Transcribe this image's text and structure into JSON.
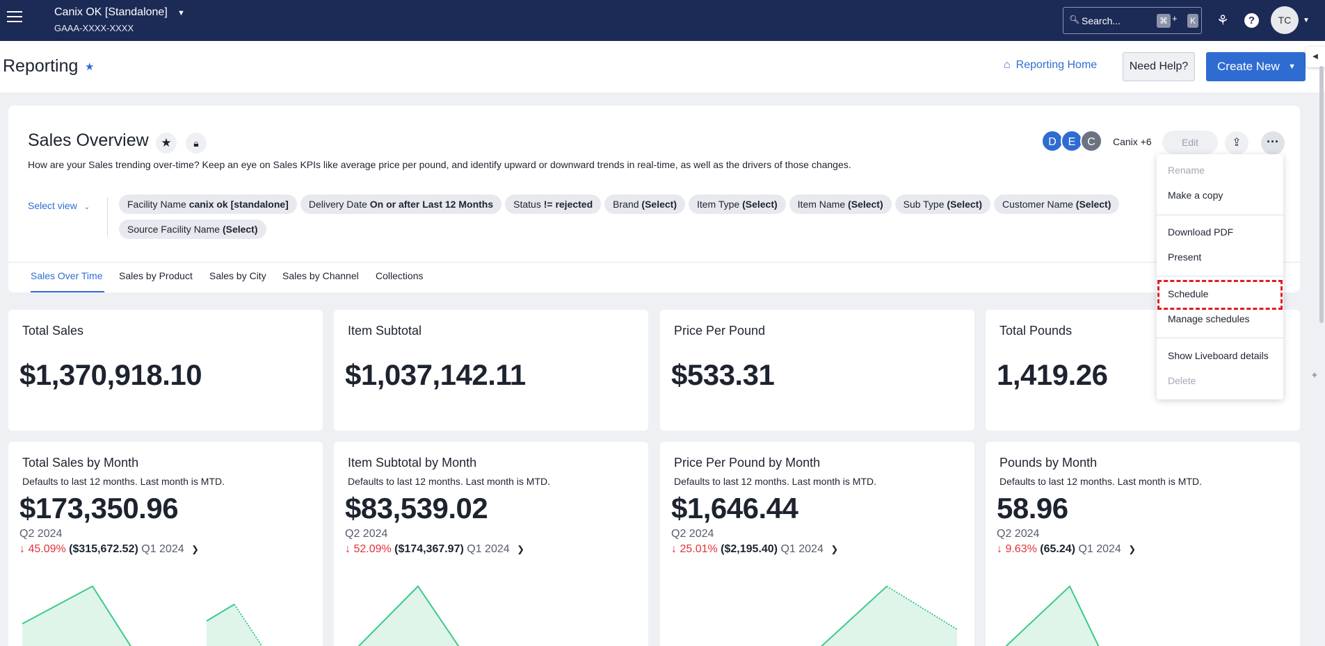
{
  "topbar": {
    "org_name": "Canix OK [Standalone]",
    "org_id": "GAAA-XXXX-XXXX",
    "search_placeholder": "Search...",
    "search_shortcut_key1": "⌘",
    "search_shortcut_plus": "+",
    "search_shortcut_key2": "K",
    "user_initials": "TC"
  },
  "header": {
    "title": "Reporting",
    "home_link": "Reporting Home",
    "help_button": "Need Help?",
    "create_button": "Create New"
  },
  "liveboard": {
    "title": "Sales Overview",
    "description": "How are your Sales trending over-time? Keep an eye on Sales KPIs like average price per pound, and identify upward or downward trends in real-time, as well as the drivers of those changes.",
    "select_view": "Select view",
    "collaborators": [
      "D",
      "E",
      "C"
    ],
    "collaborator_colors": [
      "#2f6cd2",
      "#2f6cd2",
      "#6b7280"
    ],
    "collaborators_text": "Canix +6",
    "edit_button": "Edit",
    "filters": [
      {
        "label": "Facility Name",
        "value": "canix ok [standalone]"
      },
      {
        "label": "Delivery Date",
        "value": "On or after Last 12 Months"
      },
      {
        "label": "Status",
        "value": "!= rejected"
      },
      {
        "label": "Brand",
        "value": "(Select)"
      },
      {
        "label": "Item Type",
        "value": "(Select)"
      },
      {
        "label": "Item Name",
        "value": "(Select)"
      },
      {
        "label": "Sub Type",
        "value": "(Select)"
      },
      {
        "label": "Customer Name",
        "value": "(Select)"
      },
      {
        "label": "Source Facility Name",
        "value": "(Select)"
      }
    ],
    "tabs": [
      "Sales Over Time",
      "Sales by Product",
      "Sales by City",
      "Sales by Channel",
      "Collections"
    ]
  },
  "kpis": [
    {
      "title": "Total Sales",
      "value": "$1,370,918.10"
    },
    {
      "title": "Item Subtotal",
      "value": "$1,037,142.11"
    },
    {
      "title": "Price Per Pound",
      "value": "$533.31"
    },
    {
      "title": "Total Pounds",
      "value": "1,419.26"
    }
  ],
  "monthly": [
    {
      "title": "Total Sales by Month",
      "subtitle": "Defaults to last 12 months. Last month is MTD.",
      "value": "$173,350.96",
      "period": "Q2 2024",
      "change_pct": "45.09%",
      "change_abs": "($315,672.52)",
      "prev_period": "Q1 2024"
    },
    {
      "title": "Item Subtotal by Month",
      "subtitle": "Defaults to last 12 months. Last month is MTD.",
      "value": "$83,539.02",
      "period": "Q2 2024",
      "change_pct": "52.09%",
      "change_abs": "($174,367.97)",
      "prev_period": "Q1 2024"
    },
    {
      "title": "Price Per Pound by Month",
      "subtitle": "Defaults to last 12 months. Last month is MTD.",
      "value": "$1,646.44",
      "period": "Q2 2024",
      "change_pct": "25.01%",
      "change_abs": "($2,195.40)",
      "prev_period": "Q1 2024"
    },
    {
      "title": "Pounds by Month",
      "subtitle": "Defaults to last 12 months. Last month is MTD.",
      "value": "58.96",
      "period": "Q2 2024",
      "change_pct": "9.63%",
      "change_abs": "(65.24)",
      "prev_period": "Q1 2024"
    }
  ],
  "menu": {
    "rename": "Rename",
    "make_copy": "Make a copy",
    "download_pdf": "Download PDF",
    "present": "Present",
    "schedule": "Schedule",
    "manage_schedules": "Manage schedules",
    "show_details": "Show Liveboard details",
    "delete": "Delete"
  },
  "colors": {
    "nav_bg": "#1c2a56",
    "accent": "#2f6cd2",
    "negative": "#e0323b",
    "chart_line": "#3cc98a",
    "chart_fill": "#dff5ea",
    "highlight": "#e11b22"
  }
}
